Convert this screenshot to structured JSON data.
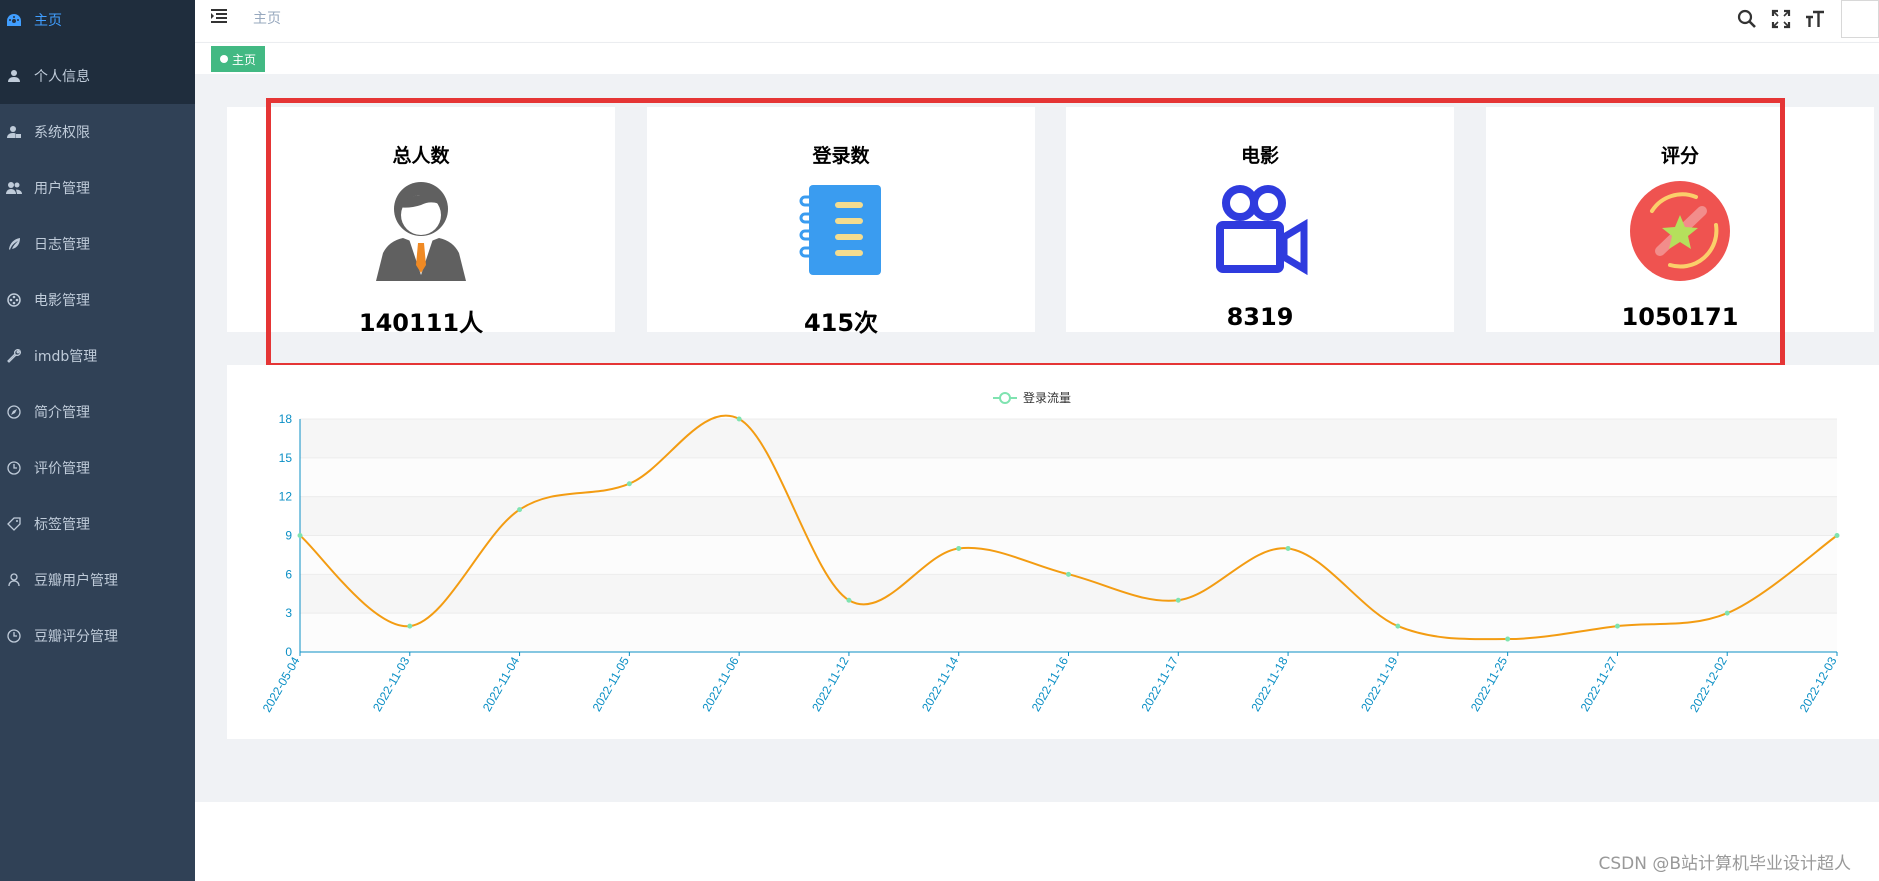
{
  "sidebar": {
    "items": [
      {
        "label": "主页",
        "icon": "dashboard-icon"
      },
      {
        "label": "个人信息",
        "icon": "user-icon"
      },
      {
        "label": "系统权限",
        "icon": "user-lock-icon"
      },
      {
        "label": "用户管理",
        "icon": "users-icon"
      },
      {
        "label": "日志管理",
        "icon": "feather-icon"
      },
      {
        "label": "电影管理",
        "icon": "film-reel-icon"
      },
      {
        "label": "imdb管理",
        "icon": "wrench-icon"
      },
      {
        "label": "简介管理",
        "icon": "compass-icon"
      },
      {
        "label": "评价管理",
        "icon": "clock-icon"
      },
      {
        "label": "标签管理",
        "icon": "tag-icon"
      },
      {
        "label": "豆瓣用户管理",
        "icon": "person-icon"
      },
      {
        "label": "豆瓣评分管理",
        "icon": "clock-icon"
      }
    ]
  },
  "header": {
    "breadcrumb": "主页",
    "icons": [
      "search-icon",
      "fullscreen-icon",
      "font-size-icon",
      "avatar"
    ]
  },
  "tags": {
    "active": "主页"
  },
  "stats": [
    {
      "title": "总人数",
      "value": "140111人",
      "icon": "businessman-icon"
    },
    {
      "title": "登录数",
      "value": "415次",
      "icon": "notebook-icon"
    },
    {
      "title": "电影",
      "value": "8319",
      "icon": "movie-camera-icon"
    },
    {
      "title": "评分",
      "value": "1050171",
      "icon": "star-badge-icon"
    }
  ],
  "colors": {
    "sidebar_bg": "#304156",
    "active_menu": "#409eff",
    "tag_green": "#42b983",
    "highlight_red": "#e53535",
    "line_orange": "#f39c12",
    "axis_blue": "#0b8fc5"
  },
  "chart_data": {
    "type": "line",
    "legend": "登录流量",
    "legend_position": "top-center",
    "smooth": true,
    "grid": true,
    "categories": [
      "2022-05-04",
      "2022-11-03",
      "2022-11-04",
      "2022-11-05",
      "2022-11-06",
      "2022-11-12",
      "2022-11-14",
      "2022-11-16",
      "2022-11-17",
      "2022-11-18",
      "2022-11-19",
      "2022-11-25",
      "2022-11-27",
      "2022-12-02",
      "2022-12-03"
    ],
    "series": [
      {
        "name": "登录流量",
        "values": [
          9,
          2,
          11,
          13,
          18,
          4,
          8,
          6,
          4,
          8,
          2,
          1,
          2,
          3,
          9
        ]
      }
    ],
    "y_ticks": [
      0,
      3,
      6,
      9,
      12,
      15,
      18
    ],
    "ylim": [
      0,
      18
    ]
  },
  "watermark": "CSDN @B站计算机毕业设计超人"
}
